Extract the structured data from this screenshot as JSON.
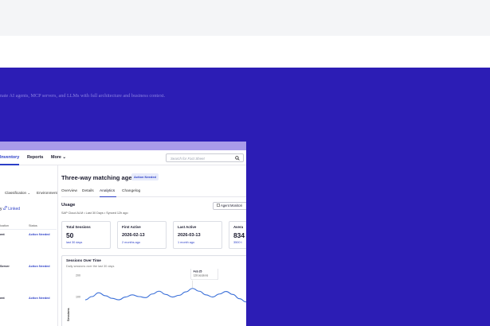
{
  "hero": {
    "tagline": "nate AI agents, MCP servers, and LLMs with full architecture and business context."
  },
  "nav": {
    "items": [
      "Inventory",
      "Reports",
      "More"
    ],
    "more_chevron": "⌄",
    "search_placeholder": "Search for Fact Sheet",
    "search_icon": "search-icon"
  },
  "list": {
    "filters": [
      "Classification",
      "Environment"
    ],
    "filter_chevron": "⌄",
    "linked_prefix": "y",
    "linked_label": "Linked",
    "col_headers": [
      "ication",
      "Status"
    ],
    "rows": [
      {
        "label": "ent",
        "status": "Action Needed"
      },
      {
        "label": "Server",
        "status": "Action Needed"
      },
      {
        "label": "ent",
        "status": "Action Needed"
      }
    ]
  },
  "detail": {
    "title": "Three-way matching agent",
    "badge": "Action Needed",
    "tabs": [
      "Overview",
      "Details",
      "Analytics",
      "Changelog"
    ],
    "active_tab": "Analytics",
    "usage_title": "Usage",
    "usage_meta": "SAP Cloud ALM  •  Last 30 Days  •  Synced 12h ago",
    "monitor_button": "Agent Monitori",
    "cards": [
      {
        "label": "Total Sessions",
        "value": "50",
        "sub": "last 30 days"
      },
      {
        "label": "First Active",
        "value": "2026-02-13",
        "sub": "2 months ago"
      },
      {
        "label": "Last Active",
        "value": "2026-03-13",
        "sub": "1 month ago"
      },
      {
        "label": "Avera",
        "value": "834",
        "sub": "3500 t"
      }
    ]
  },
  "chart_data": {
    "type": "line",
    "title": "Sessions Over Time",
    "subtitle": "Daily sessions over the last 30 days",
    "ylabel": "Sessions",
    "yticks": [
      "200",
      "100"
    ],
    "ylim": [
      0,
      200
    ],
    "tooltip": {
      "date": "Feb 25",
      "value_label": "128 sessions"
    },
    "values": [
      85,
      100,
      118,
      104,
      92,
      85,
      98,
      108,
      100,
      95,
      112,
      125,
      110,
      98,
      106,
      122,
      138,
      125,
      108,
      98,
      112,
      124,
      110,
      90,
      75
    ],
    "colors": {
      "line": "#3a6fd8",
      "accent": "#2c3fc7"
    }
  }
}
